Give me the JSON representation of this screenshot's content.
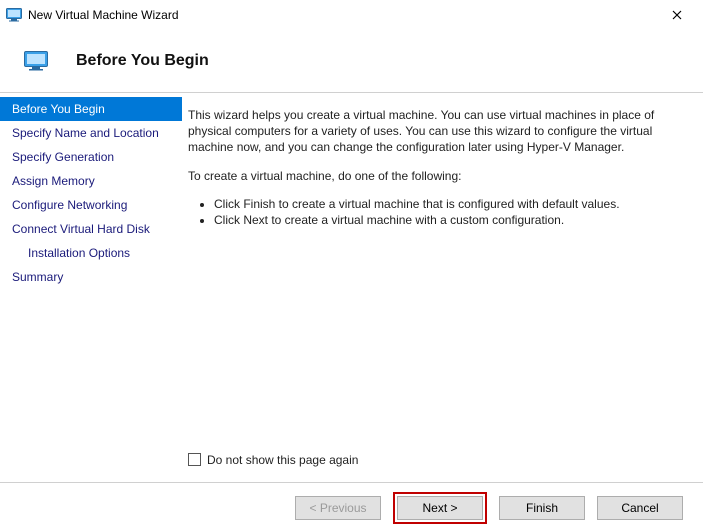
{
  "window": {
    "title": "New Virtual Machine Wizard"
  },
  "header": {
    "heading": "Before You Begin"
  },
  "nav": {
    "items": [
      {
        "label": "Before You Begin"
      },
      {
        "label": "Specify Name and Location"
      },
      {
        "label": "Specify Generation"
      },
      {
        "label": "Assign Memory"
      },
      {
        "label": "Configure Networking"
      },
      {
        "label": "Connect Virtual Hard Disk"
      },
      {
        "label": "Installation Options"
      },
      {
        "label": "Summary"
      }
    ]
  },
  "content": {
    "intro": "This wizard helps you create a virtual machine. You can use virtual machines in place of physical computers for a variety of uses. You can use this wizard to configure the virtual machine now, and you can change the configuration later using Hyper-V Manager.",
    "prompt": "To create a virtual machine, do one of the following:",
    "bullets": [
      "Click Finish to create a virtual machine that is configured with default values.",
      "Click Next to create a virtual machine with a custom configuration."
    ],
    "checkbox_label": "Do not show this page again"
  },
  "footer": {
    "previous": "< Previous",
    "next": "Next >",
    "finish": "Finish",
    "cancel": "Cancel"
  }
}
